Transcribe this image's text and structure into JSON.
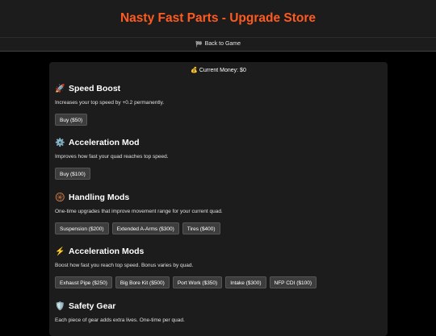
{
  "header": {
    "title": "Nasty Fast Parts - Upgrade Store"
  },
  "nav": {
    "back_label": "Back to Game",
    "back_icon": "flag-icon"
  },
  "money": {
    "label": "Current Money: $0",
    "icon": "money-bag-icon"
  },
  "sections": [
    {
      "title": "Speed Boost",
      "icon": "rocket-icon",
      "description": "Increases your top speed by +0.2 permanently.",
      "buttons": [
        "Buy ($50)"
      ]
    },
    {
      "title": "Acceleration Mod",
      "icon": "gear-icon",
      "description": "Improves how fast your quad reaches top speed.",
      "buttons": [
        "Buy ($100)"
      ]
    },
    {
      "title": "Handling Mods",
      "icon": "steering-wheel-icon",
      "description": "One-time upgrades that improve movement range for your current quad.",
      "buttons": [
        "Suspension ($200)",
        "Extended A-Arms ($300)",
        "Tires ($400)"
      ]
    },
    {
      "title": "Acceleration Mods",
      "icon": "lightning-icon",
      "description": "Boost how fast you reach top speed. Bonus varies by quad.",
      "buttons": [
        "Exhaust Pipe ($250)",
        "Big Bore Kit ($500)",
        "Port Work ($350)",
        "Intake ($300)",
        "NFP CDI ($100)"
      ]
    },
    {
      "title": "Safety Gear",
      "icon": "shield-icon",
      "description": "Each piece of gear adds extra lives. One-time per quad.",
      "buttons": []
    }
  ]
}
